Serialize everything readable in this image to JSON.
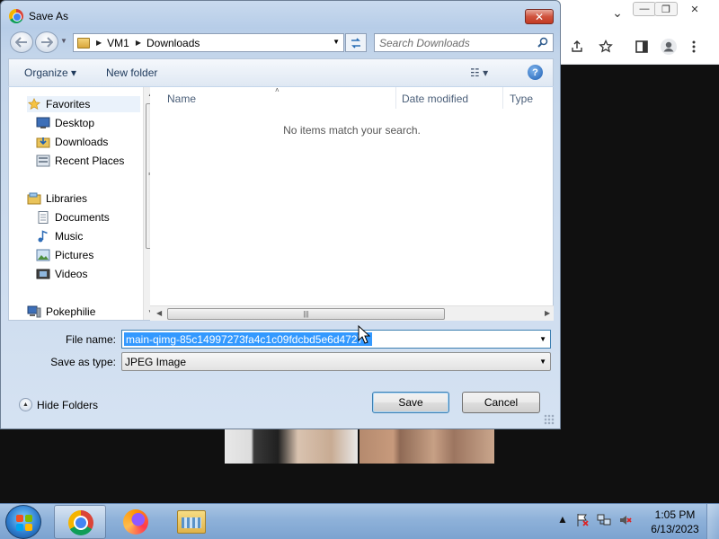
{
  "dialog": {
    "title": "Save As",
    "close_label": "✕",
    "breadcrumb": [
      "VM1",
      "Downloads"
    ],
    "search_placeholder": "Search Downloads",
    "toolbar": {
      "organize_label": "Organize ▾",
      "new_folder_label": "New folder",
      "views_label": "☷ ▾",
      "help_label": "?"
    },
    "nav": {
      "favorites": "Favorites",
      "desktop": "Desktop",
      "downloads": "Downloads",
      "recent_places": "Recent Places",
      "libraries": "Libraries",
      "documents": "Documents",
      "music": "Music",
      "pictures": "Pictures",
      "videos": "Videos",
      "pokephilie": "Pokephilie"
    },
    "columns": {
      "name": "Name",
      "date_modified": "Date modified",
      "type": "Type"
    },
    "empty_message": "No items match your search.",
    "file_name_label": "File name:",
    "file_name_value": "main-qimg-85c14997273fa4c1c09fdcbd5e6d4727",
    "save_as_type_label": "Save as type:",
    "save_as_type_value": "JPEG Image",
    "hide_folders_label": "Hide Folders",
    "save_label": "Save",
    "cancel_label": "Cancel"
  },
  "browser": {
    "minimize_label": "—",
    "restore_label": "❐",
    "close_label": "✕",
    "chevron_label": "⌄"
  },
  "taskbar": {
    "time": "1:05 PM",
    "date": "6/13/2023"
  },
  "colors": {
    "selection": "#3399ff",
    "dialog_frame": "#c9daee",
    "taskbar": "#8eb1d9"
  }
}
